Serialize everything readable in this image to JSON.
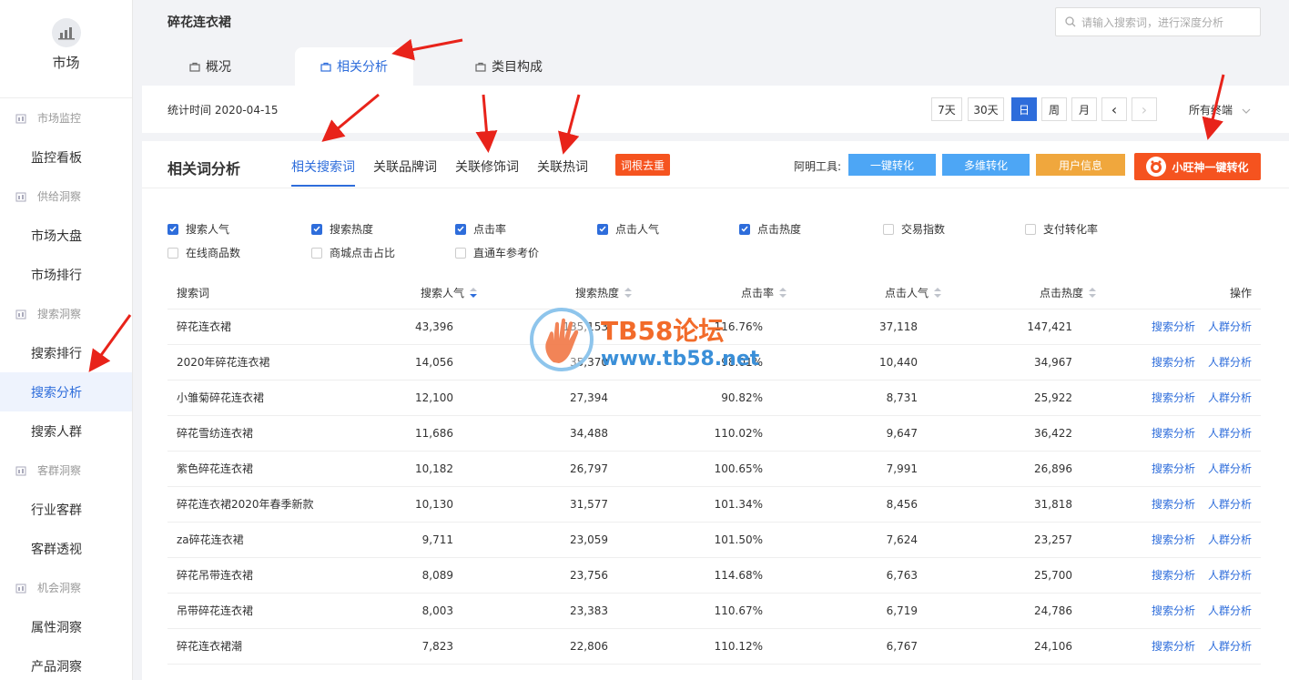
{
  "sidebar": {
    "logo_label": "市场",
    "groups": [
      {
        "label": "市场监控",
        "items": [
          "监控看板"
        ]
      },
      {
        "label": "供给洞察",
        "items": [
          "市场大盘",
          "市场排行"
        ]
      },
      {
        "label": "搜索洞察",
        "items": [
          "搜索排行",
          "搜索分析",
          "搜索人群"
        ]
      },
      {
        "label": "客群洞察",
        "items": [
          "行业客群",
          "客群透视"
        ]
      },
      {
        "label": "机会洞察",
        "items": [
          "属性洞察",
          "产品洞察"
        ]
      }
    ]
  },
  "header": {
    "title": "碎花连衣裙",
    "search_placeholder": "请输入搜索词，进行深度分析",
    "tabs": [
      "概况",
      "相关分析",
      "类目构成"
    ],
    "active_tab": "相关分析"
  },
  "subbar": {
    "stat_time": "统计时间 2020-04-15",
    "date_buttons": [
      "7天",
      "30天",
      "日",
      "周",
      "月"
    ],
    "active_date": "日",
    "prev": "‹",
    "next": "›",
    "terminal": "所有终端"
  },
  "main": {
    "title": "相关词分析",
    "subtabs": [
      "相关搜索词",
      "关联品牌词",
      "关联修饰词",
      "关联热词"
    ],
    "active_subtab": "相关搜索词",
    "dedup_label": "词根去重",
    "tools_label": "阿明工具:",
    "tool_buttons": [
      {
        "label": "一键转化",
        "color": "#4da6f5"
      },
      {
        "label": "多维转化",
        "color": "#4da6f5"
      },
      {
        "label": "用户信息",
        "color": "#f0a73d"
      }
    ],
    "xw_label": "小旺神一键转化"
  },
  "checkboxes": [
    {
      "label": "搜索人气",
      "checked": true
    },
    {
      "label": "搜索热度",
      "checked": true
    },
    {
      "label": "点击率",
      "checked": true
    },
    {
      "label": "点击人气",
      "checked": true
    },
    {
      "label": "点击热度",
      "checked": true
    },
    {
      "label": "交易指数",
      "checked": false
    },
    {
      "label": "支付转化率",
      "checked": false
    },
    {
      "label": "在线商品数",
      "checked": false
    },
    {
      "label": "商城点击占比",
      "checked": false
    },
    {
      "label": "直通车参考价",
      "checked": false
    }
  ],
  "table": {
    "headers": [
      "搜索词",
      "搜索人气",
      "搜索热度",
      "点击率",
      "点击人气",
      "点击热度",
      "操作"
    ],
    "action_labels": [
      "搜索分析",
      "人群分析"
    ],
    "rows": [
      [
        "碎花连衣裙",
        "43,396",
        "135,153",
        "116.76%",
        "37,118",
        "147,421"
      ],
      [
        "2020年碎花连衣裙",
        "14,056",
        "35,370",
        "98.01%",
        "10,440",
        "34,967"
      ],
      [
        "小雏菊碎花连衣裙",
        "12,100",
        "27,394",
        "90.82%",
        "8,731",
        "25,922"
      ],
      [
        "碎花雪纺连衣裙",
        "11,686",
        "34,488",
        "110.02%",
        "9,647",
        "36,422"
      ],
      [
        "紫色碎花连衣裙",
        "10,182",
        "26,797",
        "100.65%",
        "7,991",
        "26,896"
      ],
      [
        "碎花连衣裙2020年春季新款",
        "10,130",
        "31,577",
        "101.34%",
        "8,456",
        "31,818"
      ],
      [
        "za碎花连衣裙",
        "9,711",
        "23,059",
        "101.50%",
        "7,624",
        "23,257"
      ],
      [
        "碎花吊带连衣裙",
        "8,089",
        "23,756",
        "114.68%",
        "6,763",
        "25,700"
      ],
      [
        "吊带碎花连衣裙",
        "8,003",
        "23,383",
        "110.67%",
        "6,719",
        "24,786"
      ],
      [
        "碎花连衣裙潮",
        "7,823",
        "22,806",
        "110.12%",
        "6,767",
        "24,106"
      ]
    ]
  },
  "watermark": {
    "line1": "TB58论坛",
    "line2": "www.tb58.net"
  },
  "colors": {
    "accent": "#2e6ddb",
    "orange": "#f5531f",
    "arrow": "#e8231a"
  }
}
